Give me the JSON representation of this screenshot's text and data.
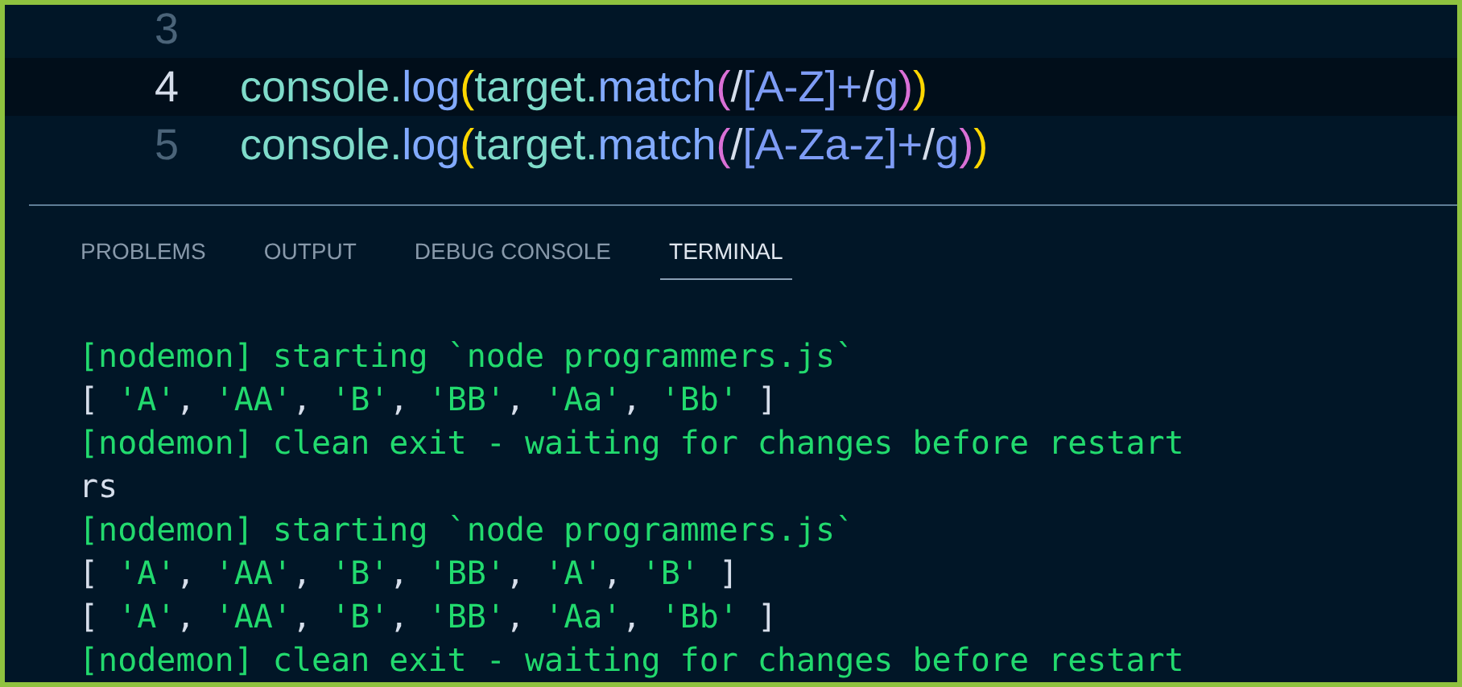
{
  "editor": {
    "lines": [
      {
        "number": "3",
        "active": false
      },
      {
        "number": "4",
        "active": true,
        "tokens": [
          {
            "kind": "var",
            "text": "console"
          },
          {
            "kind": "dot",
            "text": "."
          },
          {
            "kind": "method",
            "text": "log"
          },
          {
            "kind": "paren1",
            "text": "("
          },
          {
            "kind": "var",
            "text": "target"
          },
          {
            "kind": "dot",
            "text": "."
          },
          {
            "kind": "method",
            "text": "match"
          },
          {
            "kind": "paren2",
            "text": "("
          },
          {
            "kind": "delim",
            "text": "/"
          },
          {
            "kind": "regex",
            "text": "[A-Z]+"
          },
          {
            "kind": "delim",
            "text": "/"
          },
          {
            "kind": "regex",
            "text": "g"
          },
          {
            "kind": "paren2",
            "text": ")"
          },
          {
            "kind": "paren1",
            "text": ")"
          }
        ]
      },
      {
        "number": "5",
        "active": false,
        "tokens": [
          {
            "kind": "var",
            "text": "console"
          },
          {
            "kind": "dot",
            "text": "."
          },
          {
            "kind": "method",
            "text": "log"
          },
          {
            "kind": "paren1",
            "text": "("
          },
          {
            "kind": "var",
            "text": "target"
          },
          {
            "kind": "dot",
            "text": "."
          },
          {
            "kind": "method",
            "text": "match"
          },
          {
            "kind": "paren2",
            "text": "("
          },
          {
            "kind": "delim",
            "text": "/"
          },
          {
            "kind": "regex",
            "text": "[A-Za-z]+"
          },
          {
            "kind": "delim",
            "text": "/"
          },
          {
            "kind": "regex",
            "text": "g"
          },
          {
            "kind": "paren2",
            "text": ")"
          },
          {
            "kind": "paren1",
            "text": ")"
          }
        ]
      }
    ]
  },
  "panel": {
    "tabs": [
      {
        "label": "PROBLEMS",
        "selected": false
      },
      {
        "label": "OUTPUT",
        "selected": false
      },
      {
        "label": "DEBUG CONSOLE",
        "selected": false
      },
      {
        "label": "TERMINAL",
        "selected": true
      }
    ],
    "terminal": [
      {
        "segments": [
          {
            "kind": "green",
            "text": "[nodemon] starting `node programmers.js`"
          }
        ]
      },
      {
        "segments": [
          {
            "kind": "plain",
            "text": "[ "
          },
          {
            "kind": "green",
            "text": "'A'"
          },
          {
            "kind": "plain",
            "text": ", "
          },
          {
            "kind": "green",
            "text": "'AA'"
          },
          {
            "kind": "plain",
            "text": ", "
          },
          {
            "kind": "green",
            "text": "'B'"
          },
          {
            "kind": "plain",
            "text": ", "
          },
          {
            "kind": "green",
            "text": "'BB'"
          },
          {
            "kind": "plain",
            "text": ", "
          },
          {
            "kind": "green",
            "text": "'Aa'"
          },
          {
            "kind": "plain",
            "text": ", "
          },
          {
            "kind": "green",
            "text": "'Bb'"
          },
          {
            "kind": "plain",
            "text": " ]"
          }
        ]
      },
      {
        "segments": [
          {
            "kind": "green",
            "text": "[nodemon] clean exit - waiting for changes before restart"
          }
        ]
      },
      {
        "segments": [
          {
            "kind": "plain",
            "text": "rs"
          }
        ]
      },
      {
        "segments": [
          {
            "kind": "green",
            "text": "[nodemon] starting `node programmers.js`"
          }
        ]
      },
      {
        "segments": [
          {
            "kind": "plain",
            "text": "[ "
          },
          {
            "kind": "green",
            "text": "'A'"
          },
          {
            "kind": "plain",
            "text": ", "
          },
          {
            "kind": "green",
            "text": "'AA'"
          },
          {
            "kind": "plain",
            "text": ", "
          },
          {
            "kind": "green",
            "text": "'B'"
          },
          {
            "kind": "plain",
            "text": ", "
          },
          {
            "kind": "green",
            "text": "'BB'"
          },
          {
            "kind": "plain",
            "text": ", "
          },
          {
            "kind": "green",
            "text": "'A'"
          },
          {
            "kind": "plain",
            "text": ", "
          },
          {
            "kind": "green",
            "text": "'B'"
          },
          {
            "kind": "plain",
            "text": " ]"
          }
        ]
      },
      {
        "segments": [
          {
            "kind": "plain",
            "text": "[ "
          },
          {
            "kind": "green",
            "text": "'A'"
          },
          {
            "kind": "plain",
            "text": ", "
          },
          {
            "kind": "green",
            "text": "'AA'"
          },
          {
            "kind": "plain",
            "text": ", "
          },
          {
            "kind": "green",
            "text": "'B'"
          },
          {
            "kind": "plain",
            "text": ", "
          },
          {
            "kind": "green",
            "text": "'BB'"
          },
          {
            "kind": "plain",
            "text": ", "
          },
          {
            "kind": "green",
            "text": "'Aa'"
          },
          {
            "kind": "plain",
            "text": ", "
          },
          {
            "kind": "green",
            "text": "'Bb'"
          },
          {
            "kind": "plain",
            "text": " ]"
          }
        ]
      },
      {
        "segments": [
          {
            "kind": "green",
            "text": "[nodemon] clean exit - waiting for changes before restart"
          }
        ]
      }
    ]
  }
}
